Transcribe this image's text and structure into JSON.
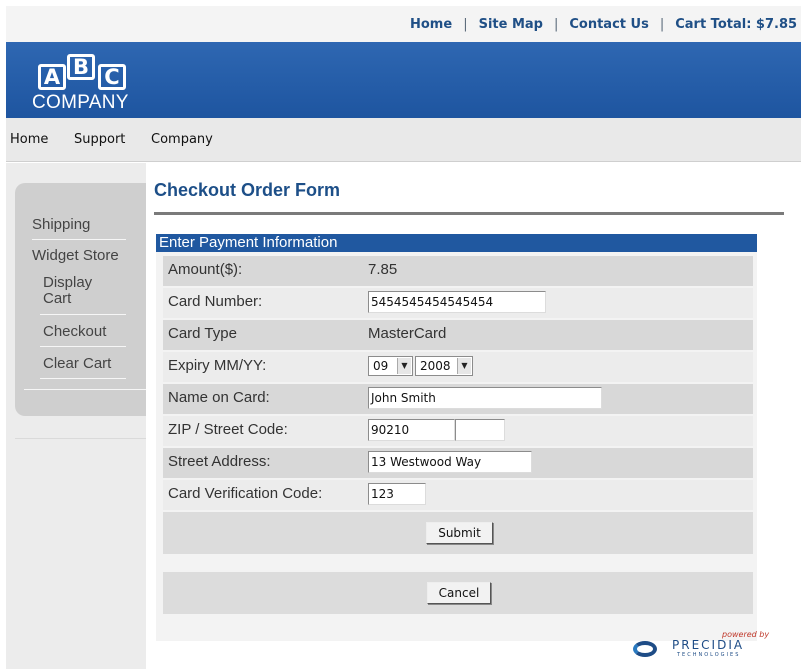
{
  "topnav": {
    "home": "Home",
    "sitemap": "Site Map",
    "contact": "Contact Us",
    "cart_total": "Cart Total: $7.85",
    "separator": "|"
  },
  "logo": {
    "a": "A",
    "b": "B",
    "c": "C",
    "company": "COMPANY"
  },
  "mainnav": {
    "items": [
      "Home",
      "Support",
      "Company"
    ]
  },
  "sidebar": {
    "items": [
      "Shipping",
      "Widget Store",
      "Display",
      "Cart",
      "Checkout",
      "Clear Cart"
    ]
  },
  "content": {
    "title": "Checkout Order Form",
    "form_header": "Enter Payment Information",
    "amount": {
      "label": "Amount($):",
      "value": "7.85"
    },
    "card_number": {
      "label": "Card Number:",
      "value": "5454545454545454"
    },
    "card_type": {
      "label": "Card Type",
      "value": "MasterCard"
    },
    "expiry": {
      "label": "Expiry MM/YY:",
      "month": "09",
      "year": "2008"
    },
    "name_on_card": {
      "label": "Name on Card:",
      "value": "John Smith"
    },
    "zip": {
      "label": "ZIP / Street Code:",
      "value": "90210",
      "value2": ""
    },
    "street": {
      "label": "Street Address:",
      "value": "13 Westwood Way"
    },
    "cvc": {
      "label": "Card Verification Code:",
      "value": "123"
    },
    "submit_label": "Submit",
    "cancel_label": "Cancel"
  },
  "footer": {
    "powered_by": "powered by",
    "brand": "PRECIDIA",
    "brand_sub": "TECHNOLOGIES"
  },
  "colors": {
    "accent": "#2058a0",
    "title": "#1d4f88",
    "link": "#1f4f86"
  }
}
